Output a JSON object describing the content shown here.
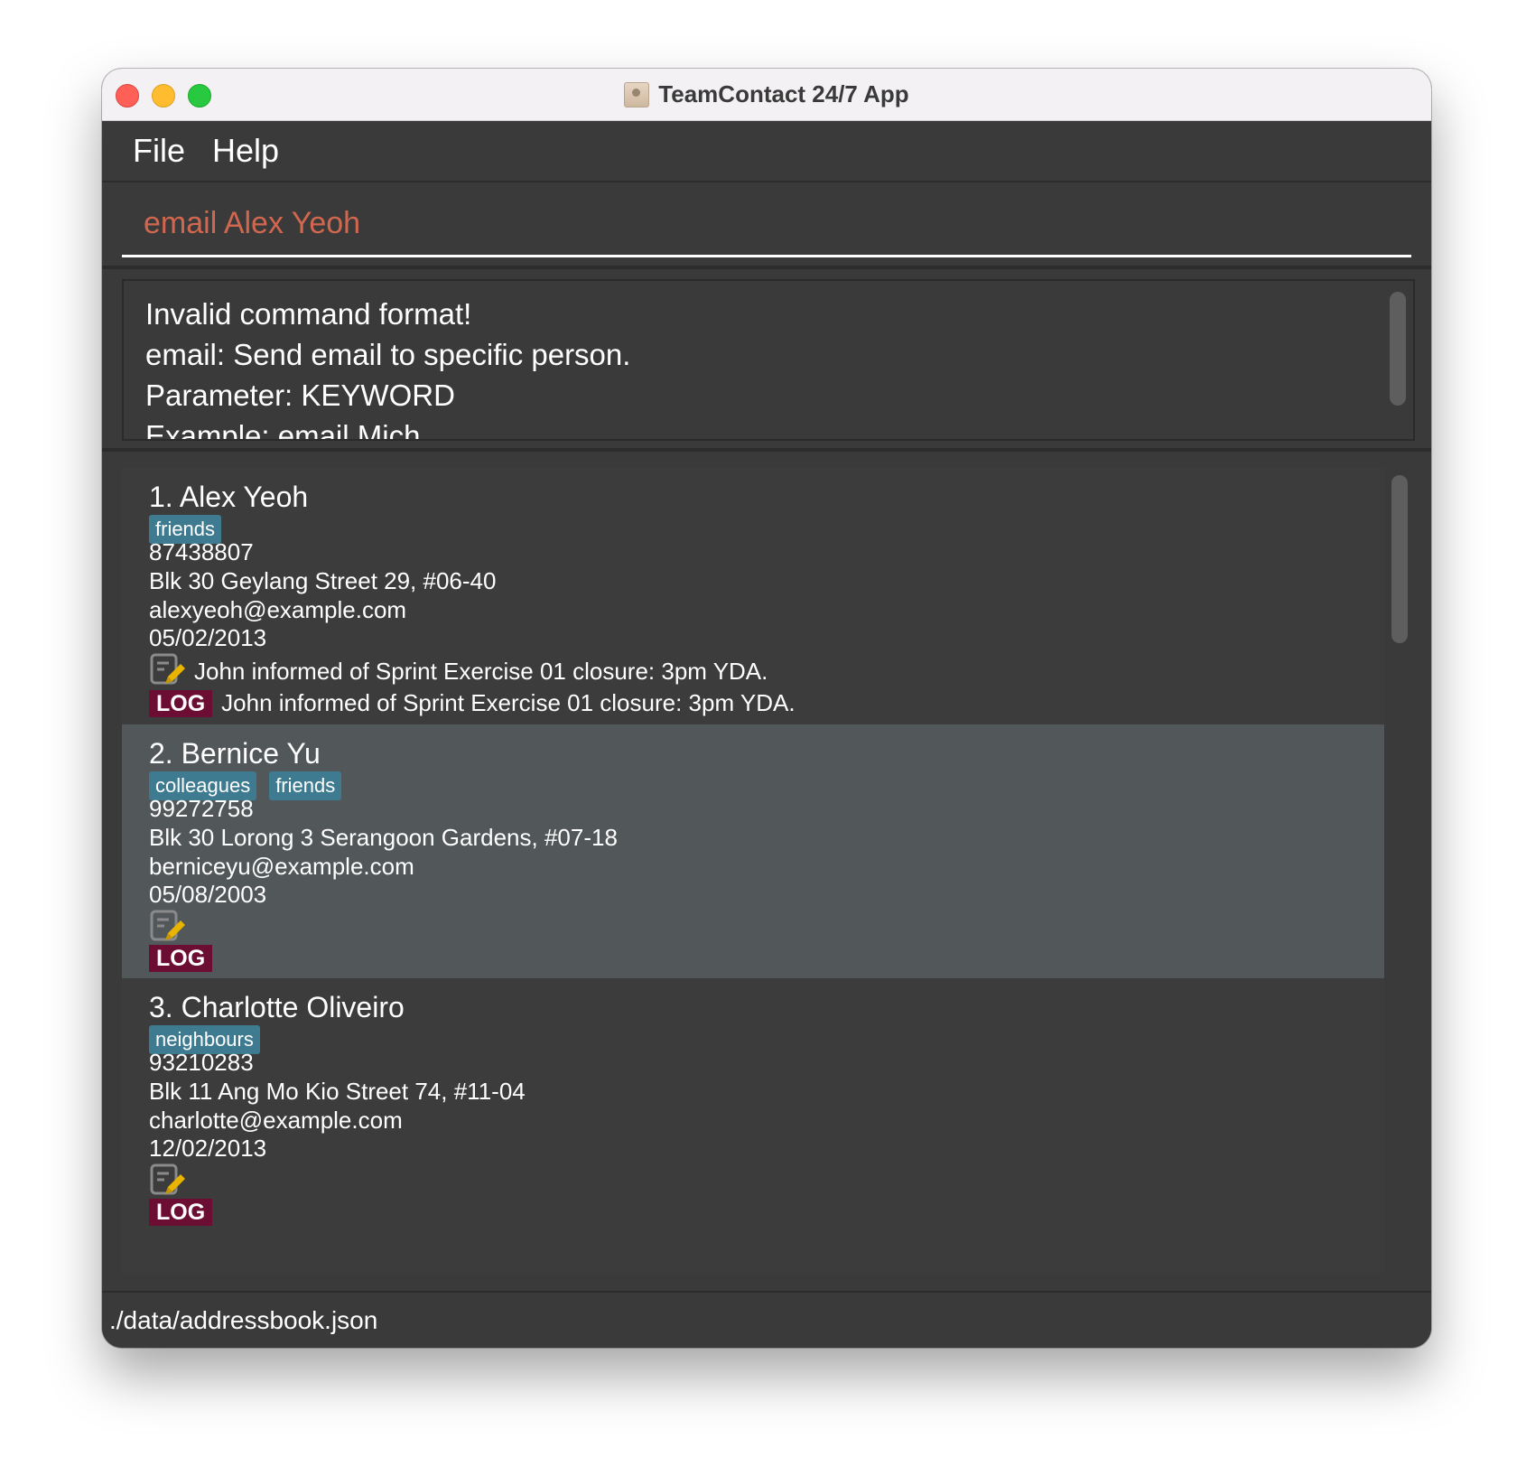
{
  "window": {
    "title": "TeamContact 24/7 App"
  },
  "menu": {
    "file": "File",
    "help": "Help"
  },
  "command": {
    "value": "email Alex Yeoh"
  },
  "result": {
    "text": "Invalid command format!\nemail: Send email to specific person.\nParameter: KEYWORD\nExample: email Mich"
  },
  "persons": [
    {
      "name": "1.  Alex Yeoh",
      "tags": [
        "friends"
      ],
      "phone": "87438807",
      "address": "Blk 30 Geylang Street 29, #06-40",
      "email": "alexyeoh@example.com",
      "date": "05/02/2013",
      "note": "John informed of Sprint Exercise 01 closure: 3pm YDA.",
      "log_label": "LOG",
      "log": "John informed of Sprint Exercise 01 closure: 3pm YDA."
    },
    {
      "name": "2.  Bernice Yu",
      "tags": [
        "colleagues",
        "friends"
      ],
      "phone": "99272758",
      "address": "Blk 30 Lorong 3 Serangoon Gardens, #07-18",
      "email": "berniceyu@example.com",
      "date": "05/08/2003",
      "note": "",
      "log_label": "LOG",
      "log": ""
    },
    {
      "name": "3.  Charlotte Oliveiro",
      "tags": [
        "neighbours"
      ],
      "phone": "93210283",
      "address": "Blk 11 Ang Mo Kio Street 74, #11-04",
      "email": "charlotte@example.com",
      "date": "12/02/2013",
      "note": "",
      "log_label": "LOG",
      "log": ""
    }
  ],
  "status": {
    "path": "./data/addressbook.json"
  },
  "colors": {
    "command_text": "#d2674f",
    "tag_bg": "#3e7b91",
    "log_badge_bg": "#6c0d34",
    "selected_card_bg": "#525759",
    "window_bg": "#3a3a3a"
  },
  "icons": {
    "note": "note-edit-icon",
    "app": "contact-app-icon"
  }
}
